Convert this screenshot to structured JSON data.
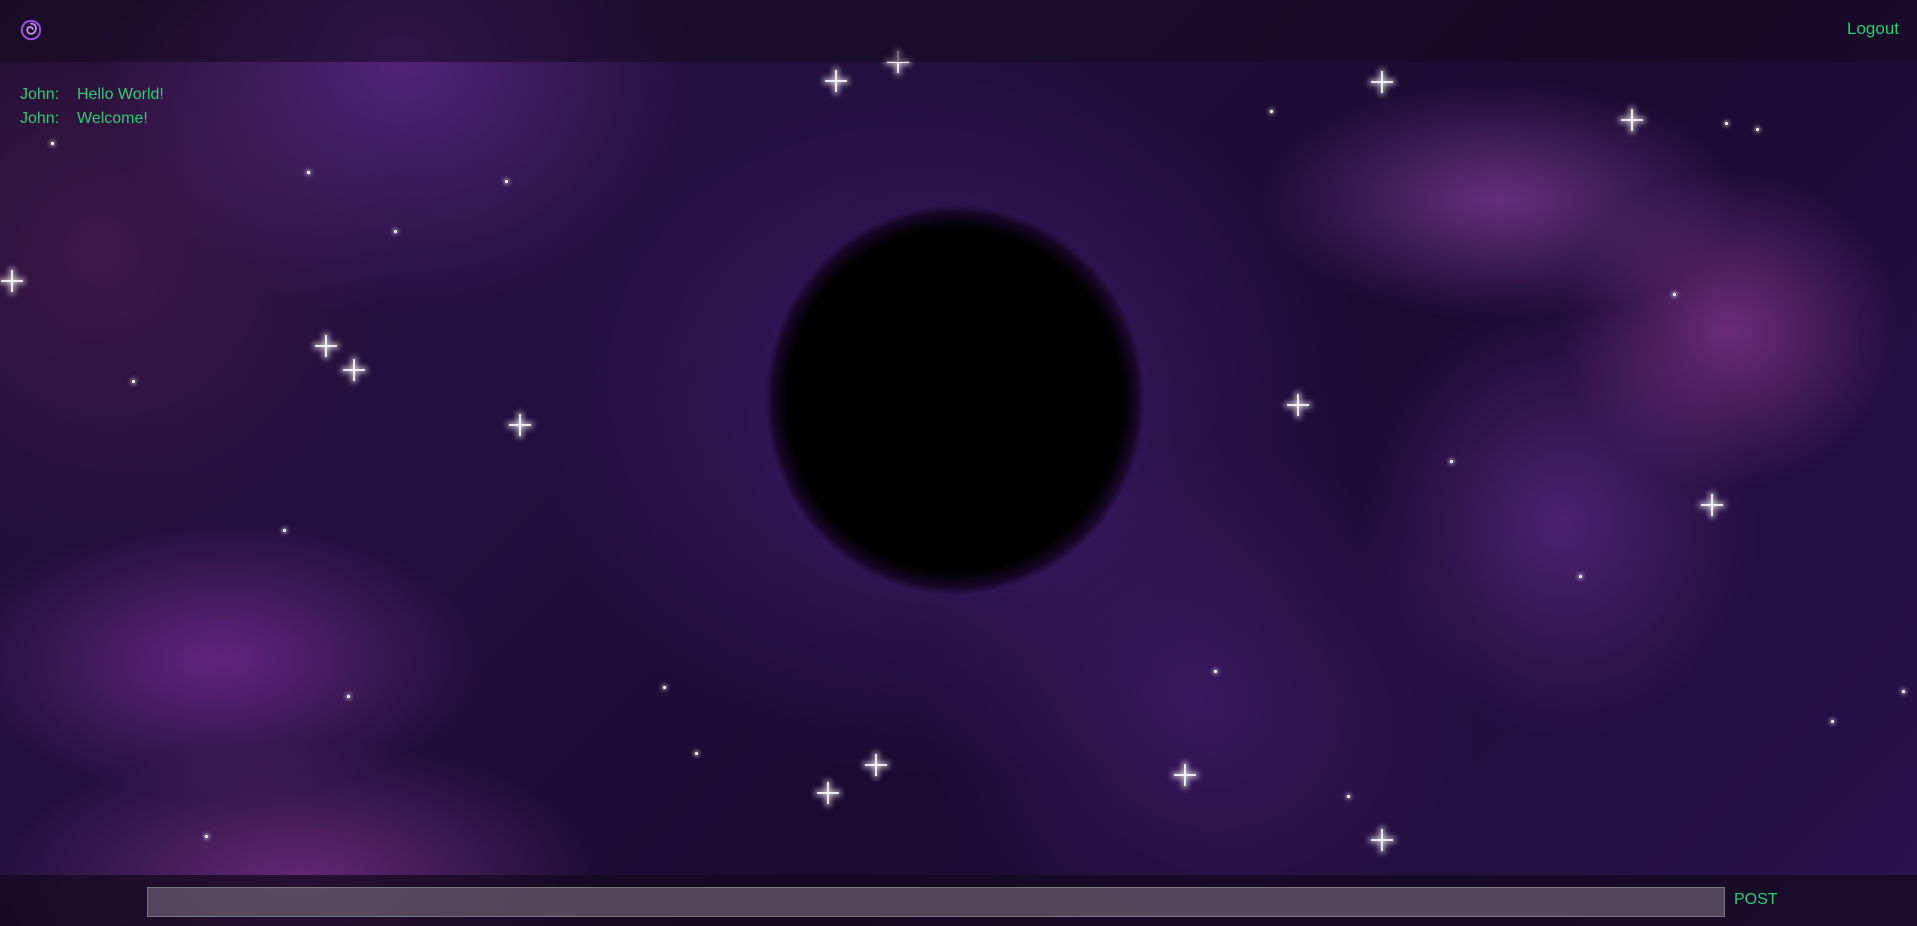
{
  "header": {
    "logo_icon": "spiral-galaxy-icon",
    "logout_label": "Logout"
  },
  "messages": [
    {
      "author": "John:",
      "text": "Hello World!"
    },
    {
      "author": "John:",
      "text": "Welcome!"
    }
  ],
  "composer": {
    "input_value": "",
    "post_label": "POST"
  },
  "colors": {
    "accent": "#2ecc71",
    "background": "#1f0e35"
  }
}
